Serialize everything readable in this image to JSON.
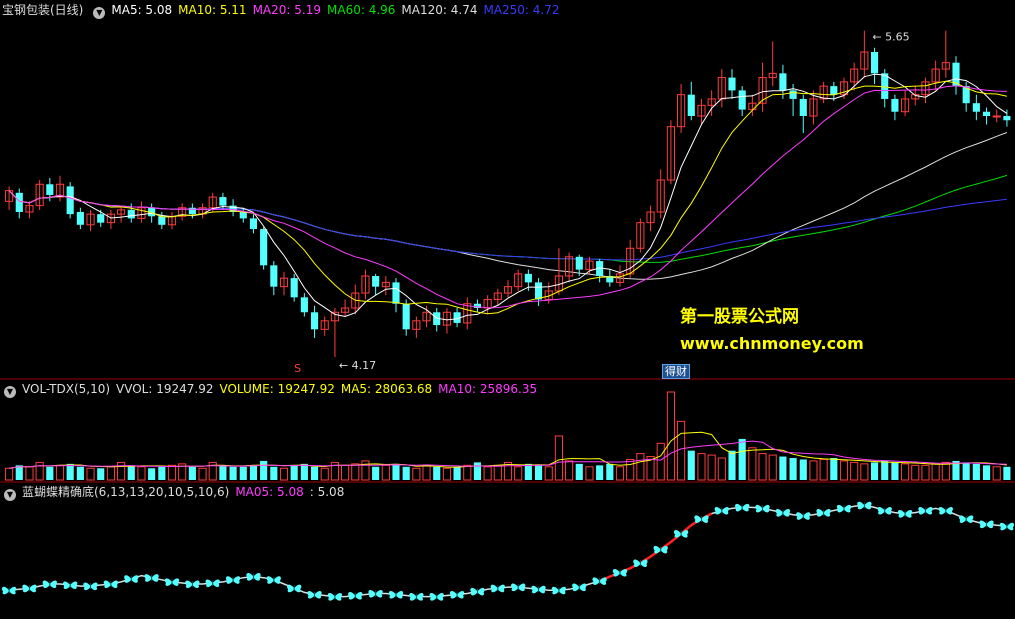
{
  "panels": {
    "main": {
      "title": "宝钢包装(日线)",
      "indicators": [
        {
          "label": "MA5: 5.08",
          "color": "#ffffff"
        },
        {
          "label": "MA10: 5.11",
          "color": "#ffff00"
        },
        {
          "label": "MA20: 5.19",
          "color": "#ff3cff"
        },
        {
          "label": "MA60: 4.96",
          "color": "#00e000"
        },
        {
          "label": "MA120: 4.74",
          "color": "#dddddd"
        },
        {
          "label": "MA250: 4.72",
          "color": "#3a3aff"
        }
      ],
      "high_label": "5.65",
      "low_label": "4.17",
      "marker_s": "S",
      "badge": "得财"
    },
    "volume": {
      "title": "VOL-TDX(5,10)",
      "indicators": [
        {
          "label": "VVOL: 19247.92",
          "color": "#dddddd"
        },
        {
          "label": "VOLUME: 19247.92",
          "color": "#ffff00"
        },
        {
          "label": "MA5: 28063.68",
          "color": "#ffff00"
        },
        {
          "label": "MA10: 25896.35",
          "color": "#ff3cff"
        }
      ]
    },
    "butterfly": {
      "title": "蓝蝴蝶精确底(6,13,13,20,10,5,10,6)",
      "indicators": [
        {
          "label": "MA05: 5.08",
          "color": "#ff3cff"
        },
        {
          "label": ": 5.08",
          "color": "#dddddd"
        }
      ]
    }
  },
  "watermark": {
    "line1": "第一股票公式网",
    "line2": "www.chnmoney.com"
  },
  "colors": {
    "up": "#ff3c3c",
    "down": "#54ffff",
    "butterfly": "#54ffff"
  },
  "chart_data": {
    "type": "candlestick",
    "price_range": [
      4.1,
      5.75
    ],
    "candles": [
      [
        4.9,
        4.95,
        4.86,
        4.97
      ],
      [
        4.94,
        4.85,
        4.82,
        4.96
      ],
      [
        4.85,
        4.88,
        4.82,
        4.9
      ],
      [
        4.88,
        4.98,
        4.86,
        5.0
      ],
      [
        4.98,
        4.93,
        4.9,
        5.01
      ],
      [
        4.92,
        4.98,
        4.9,
        5.02
      ],
      [
        4.97,
        4.84,
        4.82,
        4.99
      ],
      [
        4.85,
        4.79,
        4.77,
        4.87
      ],
      [
        4.79,
        4.84,
        4.76,
        4.86
      ],
      [
        4.84,
        4.8,
        4.78,
        4.86
      ],
      [
        4.8,
        4.84,
        4.77,
        4.86
      ],
      [
        4.84,
        4.86,
        4.8,
        4.88
      ],
      [
        4.86,
        4.82,
        4.8,
        4.89
      ],
      [
        4.82,
        4.87,
        4.8,
        4.9
      ],
      [
        4.87,
        4.83,
        4.8,
        4.89
      ],
      [
        4.83,
        4.79,
        4.77,
        4.85
      ],
      [
        4.79,
        4.83,
        4.77,
        4.85
      ],
      [
        4.83,
        4.87,
        4.81,
        4.89
      ],
      [
        4.87,
        4.84,
        4.82,
        4.89
      ],
      [
        4.84,
        4.87,
        4.82,
        4.89
      ],
      [
        4.87,
        4.92,
        4.85,
        4.94
      ],
      [
        4.92,
        4.88,
        4.86,
        4.94
      ],
      [
        4.88,
        4.85,
        4.83,
        4.91
      ],
      [
        4.85,
        4.82,
        4.8,
        4.87
      ],
      [
        4.82,
        4.77,
        4.75,
        4.84
      ],
      [
        4.77,
        4.6,
        4.58,
        4.78
      ],
      [
        4.6,
        4.5,
        4.46,
        4.62
      ],
      [
        4.5,
        4.54,
        4.46,
        4.57
      ],
      [
        4.54,
        4.45,
        4.43,
        4.56
      ],
      [
        4.45,
        4.38,
        4.36,
        4.47
      ],
      [
        4.38,
        4.3,
        4.26,
        4.41
      ],
      [
        4.3,
        4.34,
        4.27,
        4.36
      ],
      [
        4.34,
        4.38,
        4.17,
        4.4
      ],
      [
        4.38,
        4.4,
        4.36,
        4.44
      ],
      [
        4.4,
        4.47,
        4.37,
        4.51
      ],
      [
        4.47,
        4.55,
        4.44,
        4.58
      ],
      [
        4.55,
        4.5,
        4.46,
        4.56
      ],
      [
        4.5,
        4.52,
        4.46,
        4.55
      ],
      [
        4.52,
        4.42,
        4.38,
        4.54
      ],
      [
        4.42,
        4.3,
        4.27,
        4.44
      ],
      [
        4.3,
        4.34,
        4.26,
        4.36
      ],
      [
        4.34,
        4.38,
        4.31,
        4.41
      ],
      [
        4.38,
        4.32,
        4.29,
        4.4
      ],
      [
        4.32,
        4.38,
        4.28,
        4.4
      ],
      [
        4.38,
        4.33,
        4.31,
        4.4
      ],
      [
        4.33,
        4.42,
        4.3,
        4.45
      ],
      [
        4.42,
        4.4,
        4.38,
        4.44
      ],
      [
        4.4,
        4.44,
        4.37,
        4.46
      ],
      [
        4.44,
        4.47,
        4.41,
        4.49
      ],
      [
        4.47,
        4.5,
        4.45,
        4.53
      ],
      [
        4.5,
        4.56,
        4.48,
        4.58
      ],
      [
        4.56,
        4.52,
        4.48,
        4.58
      ],
      [
        4.52,
        4.44,
        4.41,
        4.54
      ],
      [
        4.44,
        4.48,
        4.42,
        4.52
      ],
      [
        4.48,
        4.55,
        4.46,
        4.68
      ],
      [
        4.55,
        4.64,
        4.52,
        4.66
      ],
      [
        4.64,
        4.58,
        4.55,
        4.65
      ],
      [
        4.58,
        4.62,
        4.56,
        4.64
      ],
      [
        4.62,
        4.55,
        4.52,
        4.63
      ],
      [
        4.55,
        4.52,
        4.5,
        4.58
      ],
      [
        4.52,
        4.56,
        4.5,
        4.6
      ],
      [
        4.56,
        4.68,
        4.54,
        4.72
      ],
      [
        4.68,
        4.8,
        4.66,
        4.82
      ],
      [
        4.8,
        4.85,
        4.76,
        4.88
      ],
      [
        4.85,
        5.0,
        4.82,
        5.05
      ],
      [
        5.0,
        5.25,
        4.98,
        5.28
      ],
      [
        5.25,
        5.4,
        5.22,
        5.45
      ],
      [
        5.4,
        5.3,
        5.28,
        5.46
      ],
      [
        5.3,
        5.35,
        5.26,
        5.38
      ],
      [
        5.35,
        5.38,
        5.3,
        5.42
      ],
      [
        5.38,
        5.48,
        5.34,
        5.52
      ],
      [
        5.48,
        5.42,
        5.38,
        5.52
      ],
      [
        5.42,
        5.33,
        5.3,
        5.44
      ],
      [
        5.33,
        5.36,
        5.3,
        5.4
      ],
      [
        5.36,
        5.48,
        5.32,
        5.55
      ],
      [
        5.48,
        5.5,
        5.44,
        5.65
      ],
      [
        5.5,
        5.42,
        5.38,
        5.54
      ],
      [
        5.42,
        5.38,
        5.3,
        5.45
      ],
      [
        5.38,
        5.3,
        5.22,
        5.4
      ],
      [
        5.3,
        5.38,
        5.26,
        5.42
      ],
      [
        5.38,
        5.44,
        5.36,
        5.46
      ],
      [
        5.44,
        5.4,
        5.37,
        5.46
      ],
      [
        5.4,
        5.46,
        5.38,
        5.48
      ],
      [
        5.46,
        5.52,
        5.42,
        5.55
      ],
      [
        5.52,
        5.6,
        5.48,
        5.7
      ],
      [
        5.6,
        5.5,
        5.45,
        5.62
      ],
      [
        5.5,
        5.38,
        5.34,
        5.52
      ],
      [
        5.38,
        5.32,
        5.28,
        5.4
      ],
      [
        5.32,
        5.38,
        5.3,
        5.42
      ],
      [
        5.38,
        5.4,
        5.35,
        5.44
      ],
      [
        5.4,
        5.46,
        5.36,
        5.48
      ],
      [
        5.46,
        5.52,
        5.42,
        5.56
      ],
      [
        5.52,
        5.55,
        5.48,
        5.7
      ],
      [
        5.55,
        5.44,
        5.4,
        5.58
      ],
      [
        5.44,
        5.36,
        5.32,
        5.46
      ],
      [
        5.36,
        5.32,
        5.28,
        5.4
      ],
      [
        5.32,
        5.3,
        5.26,
        5.34
      ],
      [
        5.3,
        5.3,
        5.27,
        5.33
      ],
      [
        5.3,
        5.28,
        5.25,
        5.33
      ]
    ],
    "volumes": [
      8,
      10,
      9,
      12,
      9,
      10,
      11,
      9,
      8,
      8,
      9,
      12,
      10,
      9,
      8,
      9,
      10,
      11,
      9,
      8,
      12,
      10,
      9,
      9,
      10,
      13,
      9,
      8,
      10,
      11,
      9,
      8,
      12,
      10,
      11,
      13,
      9,
      10,
      11,
      9,
      8,
      10,
      9,
      8,
      9,
      10,
      12,
      9,
      10,
      12,
      9,
      11,
      10,
      9,
      30,
      13,
      11,
      9,
      10,
      11,
      9,
      14,
      18,
      16,
      25,
      60,
      40,
      20,
      18,
      17,
      15,
      20,
      28,
      22,
      18,
      17,
      16,
      15,
      14,
      13,
      14,
      15,
      13,
      12,
      11,
      12,
      13,
      12,
      11,
      10,
      10,
      11,
      12,
      13,
      12,
      11,
      10,
      9,
      9
    ],
    "butterfly_line": [
      0.14,
      0.15,
      0.16,
      0.18,
      0.2,
      0.2,
      0.19,
      0.18,
      0.18,
      0.19,
      0.2,
      0.22,
      0.25,
      0.28,
      0.26,
      0.24,
      0.22,
      0.21,
      0.2,
      0.2,
      0.21,
      0.22,
      0.24,
      0.26,
      0.27,
      0.26,
      0.24,
      0.2,
      0.16,
      0.12,
      0.1,
      0.09,
      0.08,
      0.08,
      0.09,
      0.1,
      0.11,
      0.11,
      0.1,
      0.09,
      0.08,
      0.08,
      0.08,
      0.09,
      0.1,
      0.11,
      0.13,
      0.15,
      0.16,
      0.17,
      0.17,
      0.16,
      0.15,
      0.14,
      0.14,
      0.15,
      0.17,
      0.2,
      0.23,
      0.27,
      0.31,
      0.35,
      0.4,
      0.46,
      0.53,
      0.6,
      0.68,
      0.76,
      0.82,
      0.87,
      0.9,
      0.92,
      0.93,
      0.93,
      0.92,
      0.9,
      0.88,
      0.86,
      0.85,
      0.86,
      0.88,
      0.9,
      0.92,
      0.94,
      0.95,
      0.93,
      0.9,
      0.88,
      0.87,
      0.88,
      0.9,
      0.92,
      0.9,
      0.86,
      0.82,
      0.79,
      0.77,
      0.76,
      0.75
    ]
  }
}
